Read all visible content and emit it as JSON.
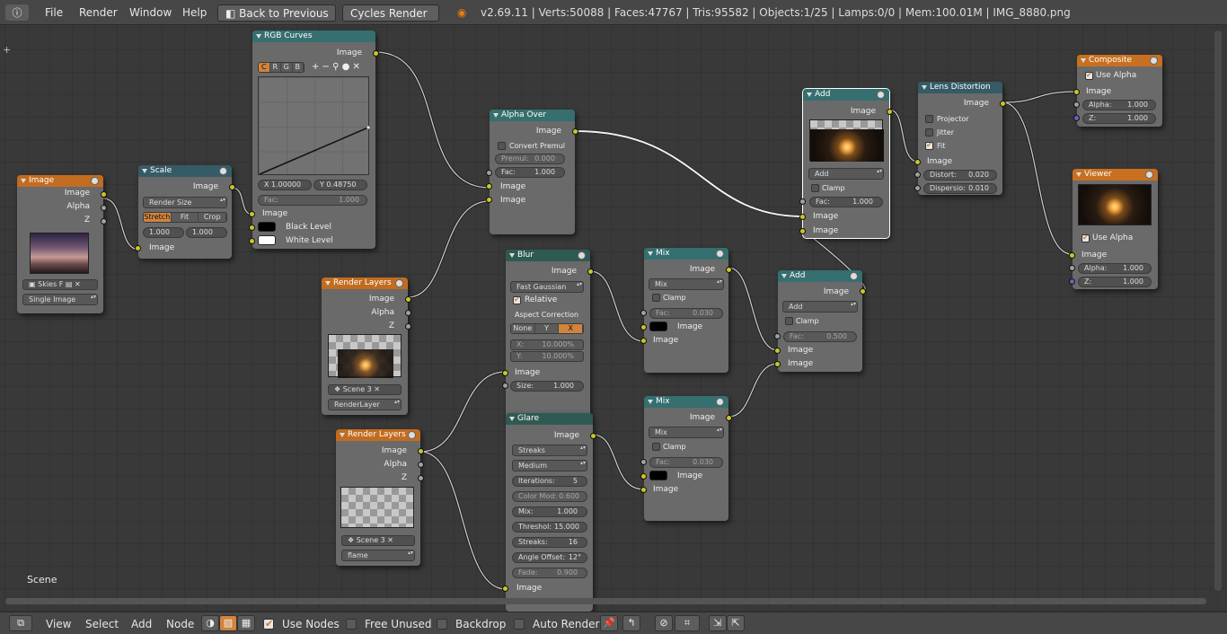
{
  "topbar": {
    "menus": [
      "File",
      "Render",
      "Window",
      "Help"
    ],
    "back_button": "Back to Previous",
    "engine": "Cycles Render",
    "stats": "v2.69.11 | Verts:50088 | Faces:47767 | Tris:95582 | Objects:1/25 | Lamps:0/0 | Mem:100.01M | IMG_8880.png"
  },
  "scene_label": "Scene",
  "nodes": {
    "image": {
      "title": "Image",
      "out_image": "Image",
      "out_alpha": "Alpha",
      "out_z": "Z",
      "in_image": "Image",
      "datablock": "Skies",
      "fake": "F",
      "source": "Single Image"
    },
    "scale": {
      "title": "Scale",
      "out_image": "Image",
      "mode": "Render Size",
      "seg": [
        "Stretch",
        "Fit",
        "Crop"
      ],
      "x": "1.000",
      "y": "1.000",
      "in_image": "Image"
    },
    "rgbcurves": {
      "title": "RGB Curves",
      "out_image": "Image",
      "channels": [
        "C",
        "R",
        "G",
        "B"
      ],
      "x": "X 1.00000",
      "y": "Y 0.48750",
      "fac": "Fac:",
      "fac_val": "1.000",
      "in_image": "Image",
      "black": "Black Level",
      "white": "White Level"
    },
    "renderlayers1": {
      "title": "Render Layers",
      "out_image": "Image",
      "out_alpha": "Alpha",
      "out_z": "Z",
      "scene": "Scene",
      "num": "3",
      "layer": "RenderLayer"
    },
    "renderlayers2": {
      "title": "Render Layers",
      "out_image": "Image",
      "out_alpha": "Alpha",
      "out_z": "Z",
      "scene": "Scene",
      "num": "3",
      "layer": "flame"
    },
    "alphaover": {
      "title": "Alpha Over",
      "out_image": "Image",
      "convert": "Convert Premul",
      "premul": "Premul:",
      "premul_val": "0.000",
      "fac": "Fac:",
      "fac_val": "1.000",
      "in1": "Image",
      "in2": "Image"
    },
    "blur": {
      "title": "Blur",
      "out_image": "Image",
      "filter": "Fast Gaussian",
      "relative": "Relative",
      "aspect": "Aspect Correction",
      "seg": [
        "None",
        "Y",
        "X"
      ],
      "x": "X:",
      "x_val": "10.000%",
      "y": "Y:",
      "y_val": "10.000%",
      "in_image": "Image",
      "size": "Size:",
      "size_val": "1.000"
    },
    "glare": {
      "title": "Glare",
      "out_image": "Image",
      "type": "Streaks",
      "quality": "Medium",
      "iterations": "Iterations:",
      "iterations_val": "5",
      "colormod": "Color Mod:",
      "colormod_val": "0.600",
      "mix": "Mix:",
      "mix_val": "1.000",
      "threshold": "Threshol:",
      "threshold_val": "15.000",
      "streaks": "Streaks:",
      "streaks_val": "16",
      "angle": "Angle Offset:",
      "angle_val": "12°",
      "fade": "Fade:",
      "fade_val": "0.900",
      "in_image": "Image"
    },
    "mix1": {
      "title": "Mix",
      "out_image": "Image",
      "mode": "Mix",
      "clamp": "Clamp",
      "fac": "Fac:",
      "fac_val": "0.030",
      "in1": "Image",
      "in2": "Image"
    },
    "mix2": {
      "title": "Mix",
      "out_image": "Image",
      "mode": "Mix",
      "clamp": "Clamp",
      "fac": "Fac:",
      "fac_val": "0.030",
      "in1": "Image",
      "in2": "Image"
    },
    "add1": {
      "title": "Add",
      "out_image": "Image",
      "mode": "Add",
      "clamp": "Clamp",
      "fac": "Fac:",
      "fac_val": "1.000",
      "in1": "Image",
      "in2": "Image"
    },
    "add2": {
      "title": "Add",
      "out_image": "Image",
      "mode": "Add",
      "clamp": "Clamp",
      "fac": "Fac:",
      "fac_val": "0.500",
      "in1": "Image",
      "in2": "Image"
    },
    "lens": {
      "title": "Lens Distortion",
      "out_image": "Image",
      "projector": "Projector",
      "jitter": "Jitter",
      "fit": "Fit",
      "in_image": "Image",
      "distort": "Distort:",
      "distort_val": "0.020",
      "dispersion": "Dispersio:",
      "dispersion_val": "0.010"
    },
    "composite": {
      "title": "Composite",
      "use_alpha": "Use Alpha",
      "in_image": "Image",
      "alpha": "Alpha:",
      "alpha_val": "1.000",
      "z": "Z:",
      "z_val": "1.000"
    },
    "viewer": {
      "title": "Viewer",
      "use_alpha": "Use Alpha",
      "in_image": "Image",
      "alpha": "Alpha:",
      "alpha_val": "1.000",
      "z": "Z:",
      "z_val": "1.000"
    }
  },
  "bottombar": {
    "menus": [
      "View",
      "Select",
      "Add",
      "Node"
    ],
    "use_nodes": "Use Nodes",
    "free_unused": "Free Unused",
    "backdrop": "Backdrop",
    "auto_render": "Auto Render"
  },
  "colors": {
    "input_header": "#c26c1f",
    "color_header": "#356f6f",
    "filter_header": "#2f5a54",
    "output_header": "#c8701f",
    "image_socket": "#c7c729",
    "value_socket": "#a0a0a0"
  }
}
